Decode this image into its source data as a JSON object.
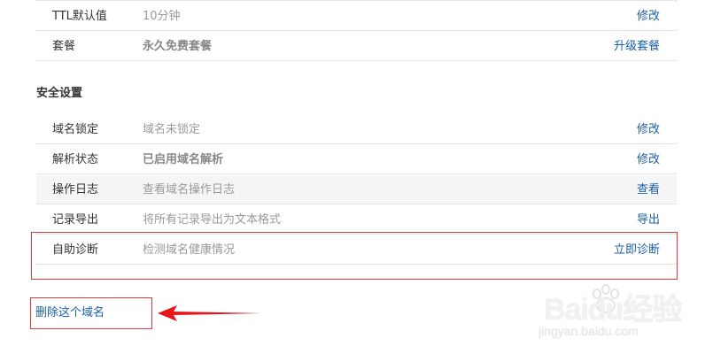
{
  "basic_settings": [
    {
      "label": "TTL默认值",
      "value": "10分钟",
      "action": "修改"
    },
    {
      "label": "套餐",
      "value": "永久免费套餐",
      "action": "升级套餐"
    }
  ],
  "security": {
    "title": "安全设置",
    "rows": [
      {
        "label": "域名锁定",
        "value": "域名未锁定",
        "action": "修改"
      },
      {
        "label": "解析状态",
        "value": "已启用域名解析",
        "action": "修改"
      },
      {
        "label": "操作日志",
        "value": "查看域名操作日志",
        "action": "查看"
      },
      {
        "label": "记录导出",
        "value": "将所有记录导出为文本格式",
        "action": "导出"
      },
      {
        "label": "自助诊断",
        "value": "检测域名健康情况",
        "action": "立即诊断"
      }
    ]
  },
  "delete_domain": "删除这个域名",
  "watermark": {
    "brand": "Baidu经验",
    "url": "jingyan.baidu.com"
  },
  "colors": {
    "link": "#1a5fa8",
    "highlight_box": "#e23a3a",
    "annotation_arrow": "#e8161b",
    "shaded_row": "#f5f5f5"
  }
}
